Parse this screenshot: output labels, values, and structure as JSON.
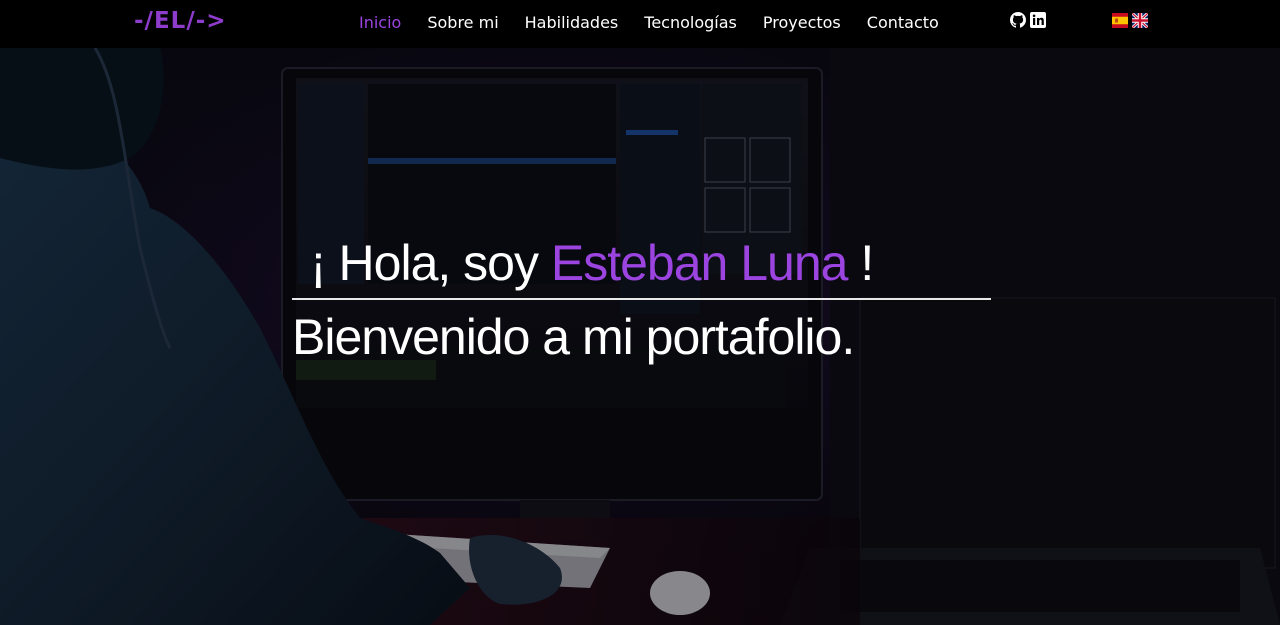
{
  "header": {
    "logo": "-/EL/->",
    "nav": [
      {
        "label": "Inicio",
        "active": true
      },
      {
        "label": "Sobre mi",
        "active": false
      },
      {
        "label": "Habilidades",
        "active": false
      },
      {
        "label": "Tecnologías",
        "active": false
      },
      {
        "label": "Proyectos",
        "active": false
      },
      {
        "label": "Contacto",
        "active": false
      }
    ],
    "social_icons": [
      "github-icon",
      "linkedin-icon"
    ],
    "language_flags": [
      "spain-flag-icon",
      "uk-flag-icon"
    ]
  },
  "hero": {
    "greeting_prefix": "¡ Hola, soy ",
    "name": "Esteban Luna",
    "greeting_suffix": " !",
    "welcome": "Bienvenido a mi portafolio."
  },
  "colors": {
    "accent": "#9b44e0",
    "logo": "#8e3ccc",
    "nav_background": "#000000",
    "text": "#ffffff"
  }
}
